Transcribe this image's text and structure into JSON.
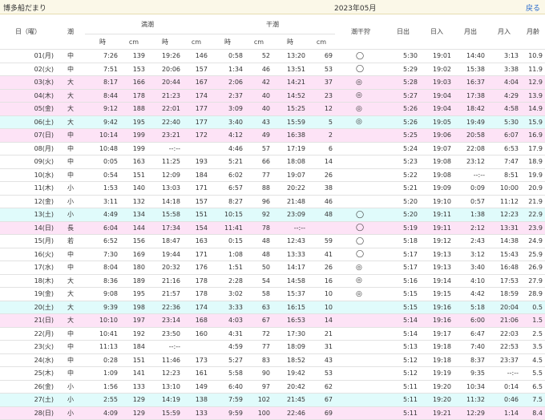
{
  "header": {
    "place": "博多船だまり",
    "month": "2023年05月",
    "back": "戻る"
  },
  "columns": {
    "date": "日（曜）",
    "tide": "潮",
    "high": "満潮",
    "low": "干潮",
    "shiohigari": "潮干狩",
    "sunrise": "日出",
    "sunset": "日入",
    "moonrise": "月出",
    "moonset": "月入",
    "moonage": "月齢",
    "time": "時",
    "cm": "cm"
  },
  "row_colors": {
    "pink": "#fde3f6",
    "cyan": "#e0fbfb"
  },
  "rows": [
    {
      "d": "01(月)",
      "t": "中",
      "h1t": "7:26",
      "h1c": "139",
      "h2t": "19:26",
      "h2c": "146",
      "l1t": "0:58",
      "l1c": "52",
      "l2t": "13:20",
      "l2c": "69",
      "s": "◯",
      "sr": "5:30",
      "ss": "19:01",
      "mr": "14:40",
      "ms": "3:13",
      "ma": "10.9",
      "bg": ""
    },
    {
      "d": "02(火)",
      "t": "中",
      "h1t": "7:51",
      "h1c": "153",
      "h2t": "20:06",
      "h2c": "157",
      "l1t": "1:34",
      "l1c": "46",
      "l2t": "13:51",
      "l2c": "53",
      "s": "◯",
      "sr": "5:29",
      "ss": "19:02",
      "mr": "15:38",
      "ms": "3:38",
      "ma": "11.9",
      "bg": ""
    },
    {
      "d": "03(水)",
      "t": "大",
      "h1t": "8:17",
      "h1c": "166",
      "h2t": "20:44",
      "h2c": "167",
      "l1t": "2:06",
      "l1c": "42",
      "l2t": "14:21",
      "l2c": "37",
      "s": "◎",
      "sr": "5:28",
      "ss": "19:03",
      "mr": "16:37",
      "ms": "4:04",
      "ma": "12.9",
      "bg": "pink"
    },
    {
      "d": "04(木)",
      "t": "大",
      "h1t": "8:44",
      "h1c": "178",
      "h2t": "21:23",
      "h2c": "174",
      "l1t": "2:37",
      "l1c": "40",
      "l2t": "14:52",
      "l2c": "23",
      "s": "◎",
      "sr": "5:27",
      "ss": "19:04",
      "mr": "17:38",
      "ms": "4:29",
      "ma": "13.9",
      "bg": "pink"
    },
    {
      "d": "05(金)",
      "t": "大",
      "h1t": "9:12",
      "h1c": "188",
      "h2t": "22:01",
      "h2c": "177",
      "l1t": "3:09",
      "l1c": "40",
      "l2t": "15:25",
      "l2c": "12",
      "s": "◎",
      "sr": "5:26",
      "ss": "19:04",
      "mr": "18:42",
      "ms": "4:58",
      "ma": "14.9",
      "bg": "pink"
    },
    {
      "d": "06(土)",
      "t": "大",
      "h1t": "9:42",
      "h1c": "195",
      "h2t": "22:40",
      "h2c": "177",
      "l1t": "3:40",
      "l1c": "43",
      "l2t": "15:59",
      "l2c": "5",
      "s": "◎",
      "sr": "5:26",
      "ss": "19:05",
      "mr": "19:49",
      "ms": "5:30",
      "ma": "15.9",
      "bg": "cyan"
    },
    {
      "d": "07(日)",
      "t": "中",
      "h1t": "10:14",
      "h1c": "199",
      "h2t": "23:21",
      "h2c": "172",
      "l1t": "4:12",
      "l1c": "49",
      "l2t": "16:38",
      "l2c": "2",
      "s": "",
      "sr": "5:25",
      "ss": "19:06",
      "mr": "20:58",
      "ms": "6:07",
      "ma": "16.9",
      "bg": "pink"
    },
    {
      "d": "08(月)",
      "t": "中",
      "h1t": "10:48",
      "h1c": "199",
      "h2t": "--:--",
      "h2c": "",
      "l1t": "4:46",
      "l1c": "57",
      "l2t": "17:19",
      "l2c": "6",
      "s": "",
      "sr": "5:24",
      "ss": "19:07",
      "mr": "22:08",
      "ms": "6:53",
      "ma": "17.9",
      "bg": ""
    },
    {
      "d": "09(火)",
      "t": "中",
      "h1t": "0:05",
      "h1c": "163",
      "h2t": "11:25",
      "h2c": "193",
      "l1t": "5:21",
      "l1c": "66",
      "l2t": "18:08",
      "l2c": "14",
      "s": "",
      "sr": "5:23",
      "ss": "19:08",
      "mr": "23:12",
      "ms": "7:47",
      "ma": "18.9",
      "bg": ""
    },
    {
      "d": "10(水)",
      "t": "中",
      "h1t": "0:54",
      "h1c": "151",
      "h2t": "12:09",
      "h2c": "184",
      "l1t": "6:02",
      "l1c": "77",
      "l2t": "19:07",
      "l2c": "26",
      "s": "",
      "sr": "5:22",
      "ss": "19:08",
      "mr": "--:--",
      "ms": "8:51",
      "ma": "19.9",
      "bg": ""
    },
    {
      "d": "11(木)",
      "t": "小",
      "h1t": "1:53",
      "h1c": "140",
      "h2t": "13:03",
      "h2c": "171",
      "l1t": "6:57",
      "l1c": "88",
      "l2t": "20:22",
      "l2c": "38",
      "s": "",
      "sr": "5:21",
      "ss": "19:09",
      "mr": "0:09",
      "ms": "10:00",
      "ma": "20.9",
      "bg": ""
    },
    {
      "d": "12(金)",
      "t": "小",
      "h1t": "3:11",
      "h1c": "132",
      "h2t": "14:18",
      "h2c": "157",
      "l1t": "8:27",
      "l1c": "96",
      "l2t": "21:48",
      "l2c": "46",
      "s": "",
      "sr": "5:20",
      "ss": "19:10",
      "mr": "0:57",
      "ms": "11:12",
      "ma": "21.9",
      "bg": ""
    },
    {
      "d": "13(土)",
      "t": "小",
      "h1t": "4:49",
      "h1c": "134",
      "h2t": "15:58",
      "h2c": "151",
      "l1t": "10:15",
      "l1c": "92",
      "l2t": "23:09",
      "l2c": "48",
      "s": "◯",
      "sr": "5:20",
      "ss": "19:11",
      "mr": "1:38",
      "ms": "12:23",
      "ma": "22.9",
      "bg": "cyan"
    },
    {
      "d": "14(日)",
      "t": "長",
      "h1t": "6:04",
      "h1c": "144",
      "h2t": "17:34",
      "h2c": "154",
      "l1t": "11:41",
      "l1c": "78",
      "l2t": "--:--",
      "l2c": "",
      "s": "◯",
      "sr": "5:19",
      "ss": "19:11",
      "mr": "2:12",
      "ms": "13:31",
      "ma": "23.9",
      "bg": "pink"
    },
    {
      "d": "15(月)",
      "t": "若",
      "h1t": "6:52",
      "h1c": "156",
      "h2t": "18:47",
      "h2c": "163",
      "l1t": "0:15",
      "l1c": "48",
      "l2t": "12:43",
      "l2c": "59",
      "s": "◯",
      "sr": "5:18",
      "ss": "19:12",
      "mr": "2:43",
      "ms": "14:38",
      "ma": "24.9",
      "bg": ""
    },
    {
      "d": "16(火)",
      "t": "中",
      "h1t": "7:30",
      "h1c": "169",
      "h2t": "19:44",
      "h2c": "171",
      "l1t": "1:08",
      "l1c": "48",
      "l2t": "13:33",
      "l2c": "41",
      "s": "◯",
      "sr": "5:17",
      "ss": "19:13",
      "mr": "3:12",
      "ms": "15:43",
      "ma": "25.9",
      "bg": ""
    },
    {
      "d": "17(水)",
      "t": "中",
      "h1t": "8:04",
      "h1c": "180",
      "h2t": "20:32",
      "h2c": "176",
      "l1t": "1:51",
      "l1c": "50",
      "l2t": "14:17",
      "l2c": "26",
      "s": "◎",
      "sr": "5:17",
      "ss": "19:13",
      "mr": "3:40",
      "ms": "16:48",
      "ma": "26.9",
      "bg": ""
    },
    {
      "d": "18(木)",
      "t": "大",
      "h1t": "8:36",
      "h1c": "189",
      "h2t": "21:16",
      "h2c": "178",
      "l1t": "2:28",
      "l1c": "54",
      "l2t": "14:58",
      "l2c": "16",
      "s": "◎",
      "sr": "5:16",
      "ss": "19:14",
      "mr": "4:10",
      "ms": "17:53",
      "ma": "27.9",
      "bg": ""
    },
    {
      "d": "19(金)",
      "t": "大",
      "h1t": "9:08",
      "h1c": "195",
      "h2t": "21:57",
      "h2c": "178",
      "l1t": "3:02",
      "l1c": "58",
      "l2t": "15:37",
      "l2c": "10",
      "s": "◎",
      "sr": "5:15",
      "ss": "19:15",
      "mr": "4:42",
      "ms": "18:59",
      "ma": "28.9",
      "bg": ""
    },
    {
      "d": "20(土)",
      "t": "大",
      "h1t": "9:39",
      "h1c": "198",
      "h2t": "22:36",
      "h2c": "174",
      "l1t": "3:33",
      "l1c": "63",
      "l2t": "16:15",
      "l2c": "10",
      "s": "",
      "sr": "5:15",
      "ss": "19:16",
      "mr": "5:18",
      "ms": "20:04",
      "ma": "0.5",
      "bg": "cyan"
    },
    {
      "d": "21(日)",
      "t": "大",
      "h1t": "10:10",
      "h1c": "197",
      "h2t": "23:14",
      "h2c": "168",
      "l1t": "4:03",
      "l1c": "67",
      "l2t": "16:53",
      "l2c": "14",
      "s": "",
      "sr": "5:14",
      "ss": "19:16",
      "mr": "6:00",
      "ms": "21:06",
      "ma": "1.5",
      "bg": "pink"
    },
    {
      "d": "22(月)",
      "t": "中",
      "h1t": "10:41",
      "h1c": "192",
      "h2t": "23:50",
      "h2c": "160",
      "l1t": "4:31",
      "l1c": "72",
      "l2t": "17:30",
      "l2c": "21",
      "s": "",
      "sr": "5:14",
      "ss": "19:17",
      "mr": "6:47",
      "ms": "22:03",
      "ma": "2.5",
      "bg": ""
    },
    {
      "d": "23(火)",
      "t": "中",
      "h1t": "11:13",
      "h1c": "184",
      "h2t": "--:--",
      "h2c": "",
      "l1t": "4:59",
      "l1c": "77",
      "l2t": "18:09",
      "l2c": "31",
      "s": "",
      "sr": "5:13",
      "ss": "19:18",
      "mr": "7:40",
      "ms": "22:53",
      "ma": "3.5",
      "bg": ""
    },
    {
      "d": "24(水)",
      "t": "中",
      "h1t": "0:28",
      "h1c": "151",
      "h2t": "11:46",
      "h2c": "173",
      "l1t": "5:27",
      "l1c": "83",
      "l2t": "18:52",
      "l2c": "43",
      "s": "",
      "sr": "5:12",
      "ss": "19:18",
      "mr": "8:37",
      "ms": "23:37",
      "ma": "4.5",
      "bg": ""
    },
    {
      "d": "25(木)",
      "t": "中",
      "h1t": "1:09",
      "h1c": "141",
      "h2t": "12:23",
      "h2c": "161",
      "l1t": "5:58",
      "l1c": "90",
      "l2t": "19:42",
      "l2c": "53",
      "s": "",
      "sr": "5:12",
      "ss": "19:19",
      "mr": "9:35",
      "ms": "--:--",
      "ma": "5.5",
      "bg": ""
    },
    {
      "d": "26(金)",
      "t": "小",
      "h1t": "1:56",
      "h1c": "133",
      "h2t": "13:10",
      "h2c": "149",
      "l1t": "6:40",
      "l1c": "97",
      "l2t": "20:42",
      "l2c": "62",
      "s": "",
      "sr": "5:11",
      "ss": "19:20",
      "mr": "10:34",
      "ms": "0:14",
      "ma": "6.5",
      "bg": ""
    },
    {
      "d": "27(土)",
      "t": "小",
      "h1t": "2:55",
      "h1c": "129",
      "h2t": "14:19",
      "h2c": "138",
      "l1t": "7:59",
      "l1c": "102",
      "l2t": "21:45",
      "l2c": "67",
      "s": "",
      "sr": "5:11",
      "ss": "19:20",
      "mr": "11:32",
      "ms": "0:46",
      "ma": "7.5",
      "bg": "cyan"
    },
    {
      "d": "28(日)",
      "t": "小",
      "h1t": "4:09",
      "h1c": "129",
      "h2t": "15:59",
      "h2c": "133",
      "l1t": "9:59",
      "l1c": "100",
      "l2t": "22:46",
      "l2c": "69",
      "s": "",
      "sr": "5:11",
      "ss": "19:21",
      "mr": "12:29",
      "ms": "1:14",
      "ma": "8.4",
      "bg": "pink"
    }
  ]
}
